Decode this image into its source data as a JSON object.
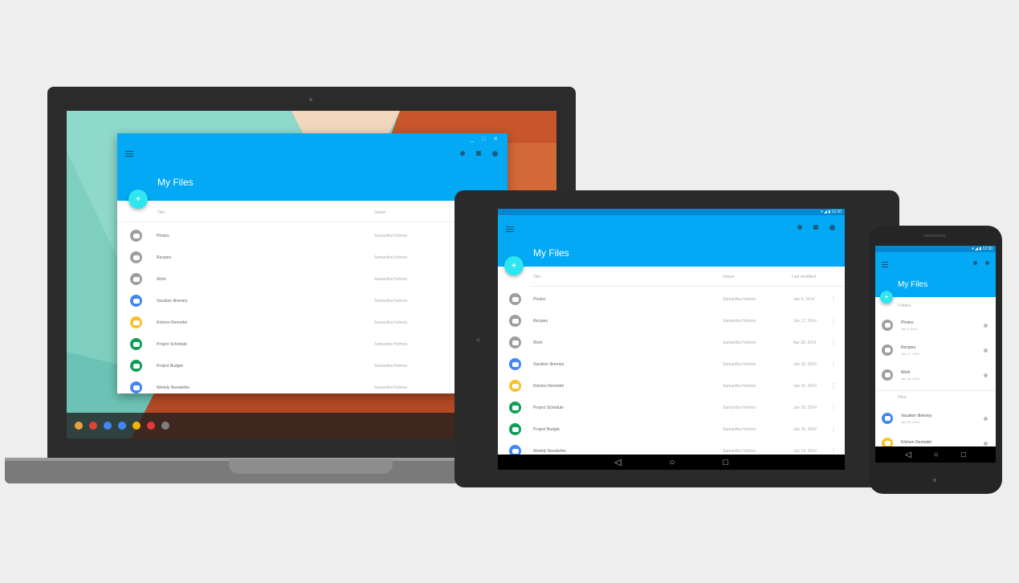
{
  "colors": {
    "primary": "#03a9f4",
    "primary_dark": "#0288d1",
    "accent": "#2ee6f0",
    "folder_grey": "#9e9e9e",
    "doc_blue": "#4285f4",
    "doc_yellow": "#fbc02d",
    "doc_green": "#0f9d58"
  },
  "app": {
    "title": "My Files",
    "fab_label": "+"
  },
  "laptop": {
    "columns": {
      "name": "Title",
      "owner": "Owner"
    },
    "files": [
      {
        "name": "Photos",
        "owner": "Samantha Holmes",
        "kind": "folder"
      },
      {
        "name": "Recipes",
        "owner": "Samantha Holmes",
        "kind": "folder"
      },
      {
        "name": "Work",
        "owner": "Samantha Holmes",
        "kind": "folder"
      },
      {
        "name": "Vacation Itinerary",
        "owner": "Samantha Holmes",
        "kind": "doc-blue"
      },
      {
        "name": "Kitchen Remodel",
        "owner": "Samantha Holmes",
        "kind": "doc-yellow"
      },
      {
        "name": "Project Schedule",
        "owner": "Samantha Holmes",
        "kind": "doc-green"
      },
      {
        "name": "Project Budget",
        "owner": "Samantha Holmes",
        "kind": "doc-green"
      },
      {
        "name": "Weekly Newsletter",
        "owner": "Samantha Holmes",
        "kind": "doc-blue"
      }
    ]
  },
  "tablet": {
    "status_time": "12:30",
    "columns": {
      "name": "Title",
      "owner": "Owner",
      "date": "Last modified"
    },
    "files": [
      {
        "name": "Photos",
        "owner": "Samantha Holmes",
        "date": "Jan 9, 2014",
        "kind": "folder"
      },
      {
        "name": "Recipes",
        "owner": "Samantha Holmes",
        "date": "Jan 17, 2014",
        "kind": "folder"
      },
      {
        "name": "Work",
        "owner": "Samantha Holmes",
        "date": "Apr 28, 2014",
        "kind": "folder"
      },
      {
        "name": "Vacation Itinerary",
        "owner": "Samantha Holmes",
        "date": "Jan 20, 2014",
        "kind": "doc-blue"
      },
      {
        "name": "Kitchen Remodel",
        "owner": "Samantha Holmes",
        "date": "Jan 10, 2014",
        "kind": "doc-yellow"
      },
      {
        "name": "Project Schedule",
        "owner": "Samantha Holmes",
        "date": "Jan 20, 2014",
        "kind": "doc-green"
      },
      {
        "name": "Project Budget",
        "owner": "Samantha Holmes",
        "date": "Jan 16, 2014",
        "kind": "doc-green"
      },
      {
        "name": "Weekly Newsletter",
        "owner": "Samantha Holmes",
        "date": "Jan 14, 2014",
        "kind": "doc-blue"
      }
    ]
  },
  "phone": {
    "status_time": "12:30",
    "sections": {
      "folders": "Folders",
      "files": "Files"
    },
    "folders": [
      {
        "name": "Photos",
        "date": "Jan 9, 2014",
        "kind": "folder"
      },
      {
        "name": "Recipes",
        "date": "Jan 17, 2014",
        "kind": "folder"
      },
      {
        "name": "Work",
        "date": "Jan 28, 2014",
        "kind": "folder"
      }
    ],
    "files": [
      {
        "name": "Vacation Itinerary",
        "date": "Jan 20, 2014",
        "kind": "doc-blue"
      },
      {
        "name": "Kitchen Remodel",
        "date": "",
        "kind": "doc-yellow"
      }
    ]
  },
  "icons": {
    "menu": "menu-icon",
    "search": "search-icon",
    "grid": "view-icon",
    "more": "more-icon",
    "nav_back": "◁",
    "nav_home": "○",
    "nav_recent": "□",
    "kebab": "⋮"
  }
}
